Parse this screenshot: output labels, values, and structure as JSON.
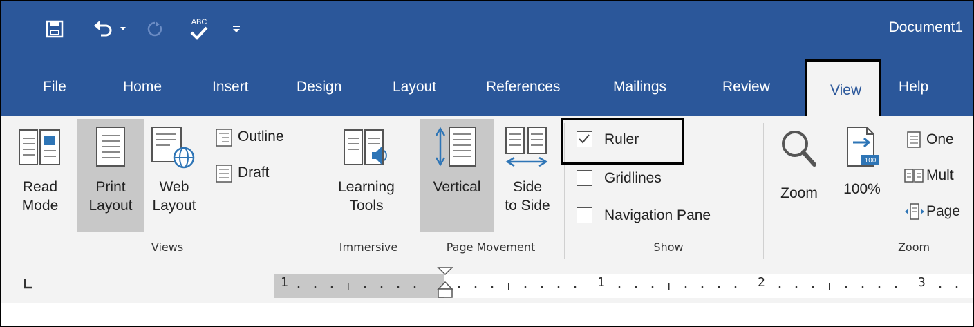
{
  "title_bar": {
    "document_title": "Document1",
    "quick_access": [
      {
        "icon": "save-icon"
      },
      {
        "icon": "undo-icon"
      },
      {
        "icon": "redo-icon"
      },
      {
        "icon": "spelling-check-icon",
        "label": "ABC"
      },
      {
        "icon": "customize-qat-icon"
      }
    ]
  },
  "tabs": [
    "File",
    "Home",
    "Insert",
    "Design",
    "Layout",
    "References",
    "Mailings",
    "Review",
    "View",
    "Help"
  ],
  "active_tab": "View",
  "ribbon": {
    "views": {
      "group_label": "Views",
      "read_mode": [
        "Read",
        "Mode"
      ],
      "print_layout": [
        "Print",
        "Layout"
      ],
      "web_layout": [
        "Web",
        "Layout"
      ],
      "outline": "Outline",
      "draft": "Draft"
    },
    "immersive": {
      "group_label": "Immersive",
      "learning_tools": [
        "Learning",
        "Tools"
      ]
    },
    "page_movement": {
      "group_label": "Page Movement",
      "vertical": "Vertical",
      "side_to_side": [
        "Side",
        "to Side"
      ]
    },
    "show": {
      "group_label": "Show",
      "ruler": {
        "label": "Ruler",
        "checked": true
      },
      "gridlines": {
        "label": "Gridlines",
        "checked": false
      },
      "navigation_pane": {
        "label": "Navigation Pane",
        "checked": false
      }
    },
    "zoom": {
      "group_label": "Zoom",
      "zoom": "Zoom",
      "hundred": "100%",
      "hundred_badge": "100",
      "one_page": "One",
      "multiple_pages": "Mult",
      "page_width": "Page"
    }
  },
  "ruler": {
    "tab_selector": "L",
    "numbers": [
      "1",
      "1",
      "2",
      "3"
    ]
  },
  "colors": {
    "title_blue": "#2b579a",
    "ribbon_bg": "#f3f3f3",
    "selected_bg": "#c8c8c8",
    "icon_blue": "#2e75b6"
  }
}
